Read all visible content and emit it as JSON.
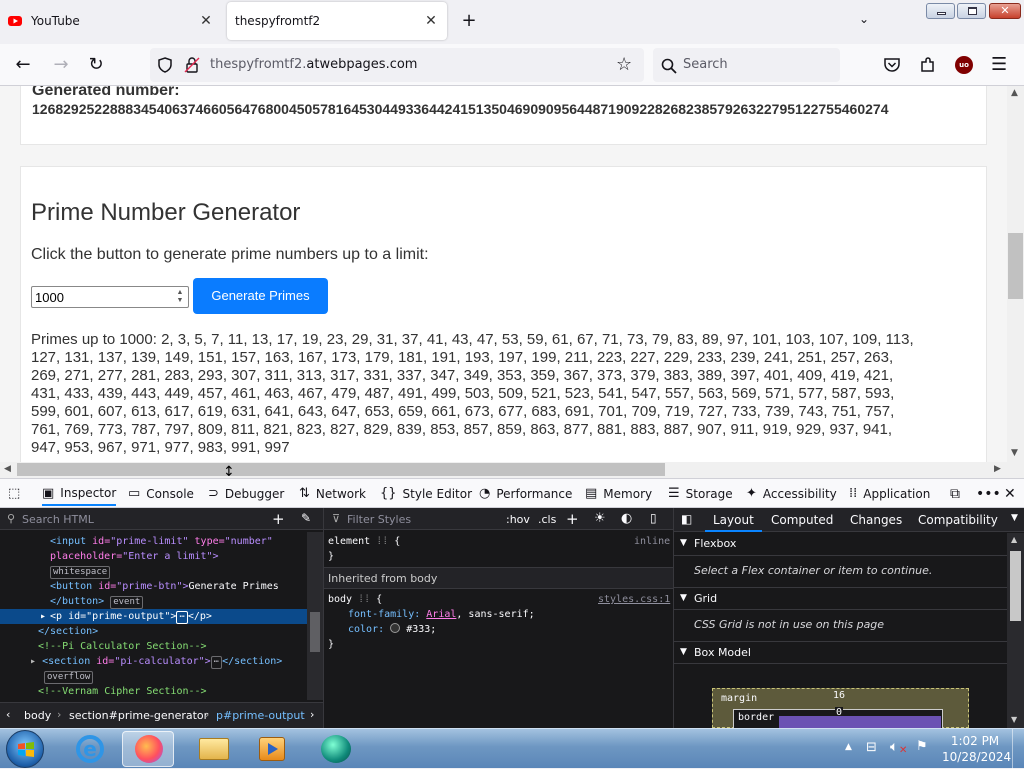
{
  "tabs": [
    {
      "title": "YouTube",
      "active": false
    },
    {
      "title": "thespyfromtf2",
      "active": true
    }
  ],
  "address": {
    "host_prefix": "thespyfromtf2.",
    "host_domain": "atwebpages.com"
  },
  "search": {
    "placeholder": "Search"
  },
  "page": {
    "generated_label": "Generated number:",
    "generated_value": "12682925228883454063746605647680045057816453044933644241513504690909564487190922826823857926322795122755460274",
    "prime_title": "Prime Number Generator",
    "prime_desc": "Click the button to generate prime numbers up to a limit:",
    "prime_input_value": "1000",
    "prime_button": "Generate Primes",
    "prime_output_lines": [
      "Primes up to 1000: 2, 3, 5, 7, 11, 13, 17, 19, 23, 29, 31, 37, 41, 43, 47, 53, 59, 61, 67, 71, 73, 79, 83, 89, 97, 101, 103, 107, 109, 113,",
      "127, 131, 137, 139, 149, 151, 157, 163, 167, 173, 179, 181, 191, 193, 197, 199, 211, 223, 227, 229, 233, 239, 241, 251, 257, 263,",
      "269, 271, 277, 281, 283, 293, 307, 311, 313, 317, 331, 337, 347, 349, 353, 359, 367, 373, 379, 383, 389, 397, 401, 409, 419, 421,",
      "431, 433, 439, 443, 449, 457, 461, 463, 467, 479, 487, 491, 499, 503, 509, 521, 523, 541, 547, 557, 563, 569, 571, 577, 587, 593,",
      "599, 601, 607, 613, 617, 619, 631, 641, 643, 647, 653, 659, 661, 673, 677, 683, 691, 701, 709, 719, 727, 733, 739, 743, 751, 757,",
      "761, 769, 773, 787, 797, 809, 811, 821, 823, 827, 829, 839, 853, 857, 859, 863, 877, 881, 883, 887, 907, 911, 919, 929, 937, 941,",
      "947, 953, 967, 971, 977, 983, 991, 997"
    ]
  },
  "devtools": {
    "tabs": [
      "Inspector",
      "Console",
      "Debugger",
      "Network",
      "Style Editor",
      "Performance",
      "Memory",
      "Storage",
      "Accessibility",
      "Application"
    ],
    "search_html_placeholder": "Search HTML",
    "filter_styles_placeholder": "Filter Styles",
    "hov": ":hov",
    "cls": ".cls",
    "markup": {
      "l1_tag": "<input",
      "l1_a1": "id=",
      "l1_v1": "\"prime-limit\"",
      "l1_a2": "type=",
      "l1_v2": "\"number\"",
      "l2_a": "placeholder=",
      "l2_v": "\"Enter a limit\">",
      "badge_whitespace": "whitespace",
      "l3_tag": "<button",
      "l3_a": "id=",
      "l3_v": "\"prime-btn\">",
      "l3_text": "Generate Primes",
      "l4_tag": "</button>",
      "badge_event": "event",
      "l5_tag": "<p",
      "l5_a": "id=",
      "l5_v": "\"prime-output\">",
      "l5_close": "</p>",
      "l6_tag": "</section>",
      "l7_comment": "<!--Pi Calculator Section-->",
      "l8_tag": "<section",
      "l8_a": "id=",
      "l8_v": "\"pi-calculator\">",
      "l8_close": "</section>",
      "badge_overflow": "overflow",
      "l9_comment": "<!--Vernam Cipher Section-->"
    },
    "breadcrumbs": [
      "body",
      "section#prime-generator",
      "p#prime-output"
    ],
    "rules": {
      "element_sel": "element",
      "element_brace": "{",
      "element_close": "}",
      "inline": "inline",
      "inherited": "Inherited from body",
      "body_sel": "body",
      "body_brace": "{",
      "source": "styles.css:1",
      "p1_name": "font-family:",
      "p1_link": "Arial",
      "p1_rest": ", sans-serif;",
      "p2_name": "color:",
      "p2_val": "#333;",
      "close": "}"
    },
    "side_tabs": [
      "Layout",
      "Computed",
      "Changes",
      "Compatibility"
    ],
    "flexbox_title": "Flexbox",
    "flexbox_msg": "Select a Flex container or item to continue.",
    "grid_title": "Grid",
    "grid_msg": "CSS Grid is not in use on this page",
    "boxmodel_title": "Box Model",
    "bm_margin": "margin",
    "bm_margin_val": "16",
    "bm_border": "border",
    "bm_border_val": "0"
  },
  "taskbar": {
    "time": "1:02 PM",
    "date": "10/28/2024"
  }
}
